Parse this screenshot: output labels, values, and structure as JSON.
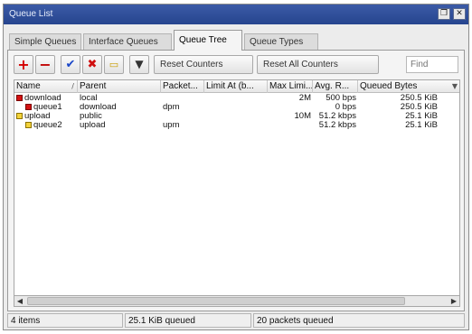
{
  "window": {
    "title": "Queue List",
    "restore_icon": "restore-icon",
    "close_icon": "close-icon"
  },
  "tabs": [
    {
      "label": "Simple Queues",
      "active": false
    },
    {
      "label": "Interface Queues",
      "active": false
    },
    {
      "label": "Queue Tree",
      "active": true
    },
    {
      "label": "Queue Types",
      "active": false
    }
  ],
  "toolbar": {
    "add_icon": "plus-icon",
    "remove_icon": "minus-icon",
    "enable_icon": "check-icon",
    "disable_icon": "cross-icon",
    "comment_icon": "comment-icon",
    "filter_icon": "filter-icon",
    "reset_counters_label": "Reset Counters",
    "reset_all_counters_label": "Reset All Counters",
    "find_placeholder": "Find"
  },
  "table": {
    "columns": [
      "Name",
      "Parent",
      "Packet...",
      "Limit At (b...",
      "Max Limi...",
      "Avg. R...",
      "Queued Bytes"
    ],
    "rows": [
      {
        "name": "download",
        "icon": "red",
        "indent": 0,
        "parent": "local",
        "packet_mark": "",
        "limit_at": "",
        "max_limit": "2M",
        "avg_rate": "500 bps",
        "queued_bytes": "250.5 KiB"
      },
      {
        "name": "queue1",
        "icon": "red",
        "indent": 1,
        "parent": "download",
        "packet_mark": "dpm",
        "limit_at": "",
        "max_limit": "",
        "avg_rate": "0 bps",
        "queued_bytes": "250.5 KiB"
      },
      {
        "name": "upload",
        "icon": "yellow",
        "indent": 0,
        "parent": "public",
        "packet_mark": "",
        "limit_at": "",
        "max_limit": "10M",
        "avg_rate": "51.2 kbps",
        "queued_bytes": "25.1 KiB"
      },
      {
        "name": "queue2",
        "icon": "yellow",
        "indent": 1,
        "parent": "upload",
        "packet_mark": "upm",
        "limit_at": "",
        "max_limit": "",
        "avg_rate": "51.2 kbps",
        "queued_bytes": "25.1 KiB"
      }
    ]
  },
  "scrollbar": {
    "left_icon": "arrow-left-icon",
    "right_icon": "arrow-right-icon"
  },
  "status": {
    "items": "4 items",
    "bytes": "25.1 KiB queued",
    "packets": "20 packets queued"
  }
}
